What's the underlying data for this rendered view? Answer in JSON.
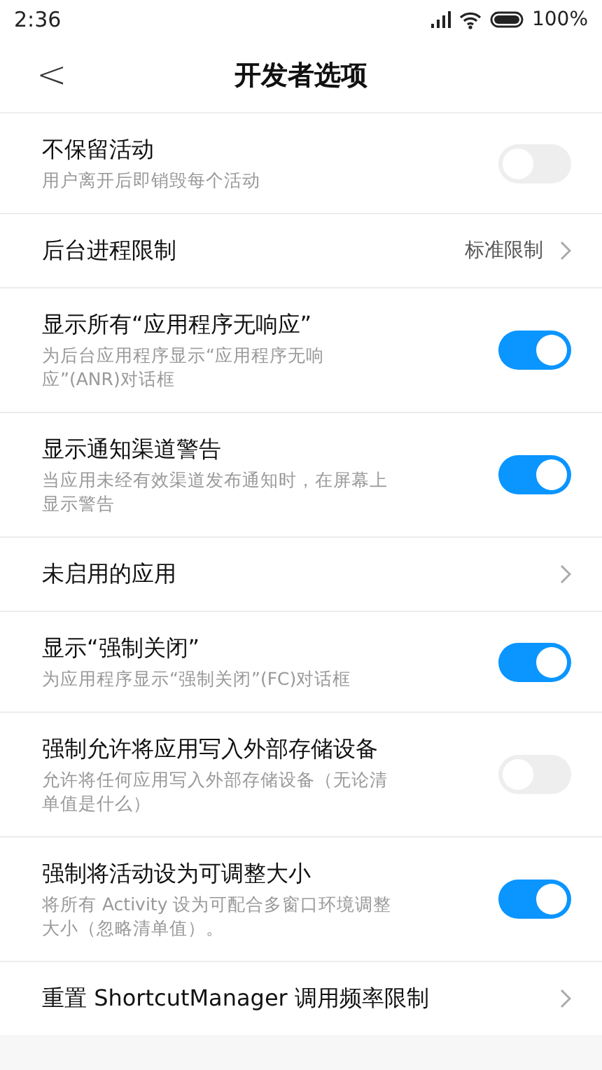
{
  "status_bar": {
    "time": "2:36",
    "battery": "100%"
  },
  "header": {
    "back": "<",
    "title": "开发者选项"
  },
  "items": [
    {
      "kind": "toggle",
      "title": "不保留活动",
      "description": "用户离开后即销毁每个活动",
      "on": false
    },
    {
      "kind": "nav",
      "title": "后台进程限制",
      "value": "标准限制"
    },
    {
      "kind": "toggle",
      "title": "显示所有“应用程序无响应”",
      "description": "为后台应用程序显示“应用程序无响应”(ANR)对话框",
      "on": true
    },
    {
      "kind": "toggle",
      "title": "显示通知渠道警告",
      "description": "当应用未经有效渠道发布通知时，在屏幕上显示警告",
      "on": true
    },
    {
      "kind": "nav",
      "title": "未启用的应用"
    },
    {
      "kind": "toggle",
      "title": "显示“强制关闭”",
      "description": "为应用程序显示“强制关闭”(FC)对话框",
      "on": true
    },
    {
      "kind": "toggle",
      "title": "强制允许将应用写入外部存储设备",
      "description": "允许将任何应用写入外部存储设备（无论清单值是什么）",
      "on": false
    },
    {
      "kind": "toggle",
      "title": "强制将活动设为可调整大小",
      "description": "将所有 Activity 设为可配合多窗口环境调整大小（忽略清单值）。",
      "on": true
    },
    {
      "kind": "nav",
      "title": "重置 ShortcutManager 调用频率限制"
    }
  ]
}
